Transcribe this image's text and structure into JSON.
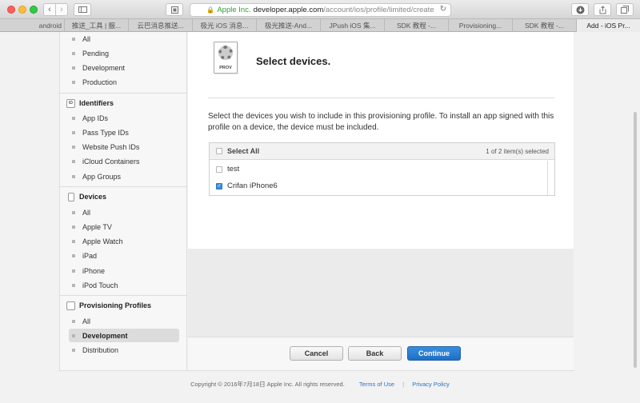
{
  "browser": {
    "url": {
      "organization": "Apple Inc.",
      "domain": "developer.apple.com",
      "path": "/account/ios/profile/limited/create"
    },
    "tabs": [
      "android",
      "推送_工具 | 服...",
      "云巴消息推送...",
      "极光 iOS 消息...",
      "极光推送-And...",
      "JPush iOS 集...",
      "SDK 教程 -...",
      "Provisioning...",
      "SDK 教程 -...",
      "Add - iOS Pr..."
    ],
    "active_tab_index": 9
  },
  "sidebar": {
    "certificates_items": [
      "All",
      "Pending",
      "Development",
      "Production"
    ],
    "identifiers": {
      "title": "Identifiers",
      "icon_text": "ID",
      "items": [
        "App IDs",
        "Pass Type IDs",
        "Website Push IDs",
        "iCloud Containers",
        "App Groups"
      ]
    },
    "devices": {
      "title": "Devices",
      "items": [
        "All",
        "Apple TV",
        "Apple Watch",
        "iPad",
        "iPhone",
        "iPod Touch"
      ]
    },
    "provisioning": {
      "title": "Provisioning Profiles",
      "items": [
        "All",
        "Development",
        "Distribution"
      ],
      "selected": "Development"
    }
  },
  "main": {
    "prov_icon_label": "PROV",
    "title": "Select devices.",
    "instruction": "Select the devices you wish to include in this provisioning profile. To install an app signed with this profile on a device, the device must be included.",
    "table": {
      "select_all_label": "Select All",
      "count_text": "1  of 2 item(s) selected",
      "rows": [
        {
          "name": "test",
          "checked": false
        },
        {
          "name": "Crifan iPhone6",
          "checked": true
        }
      ]
    },
    "buttons": {
      "cancel": "Cancel",
      "back": "Back",
      "continue": "Continue"
    }
  },
  "footer": {
    "copyright": "Copyright © 2016年7月18日 Apple Inc. All rights reserved.",
    "terms": "Terms of Use",
    "privacy": "Privacy Policy"
  },
  "colors": {
    "accent_blue": "#2d73c3",
    "secure_green": "#2e9e3e",
    "primary_button": "#1f6fc4"
  }
}
